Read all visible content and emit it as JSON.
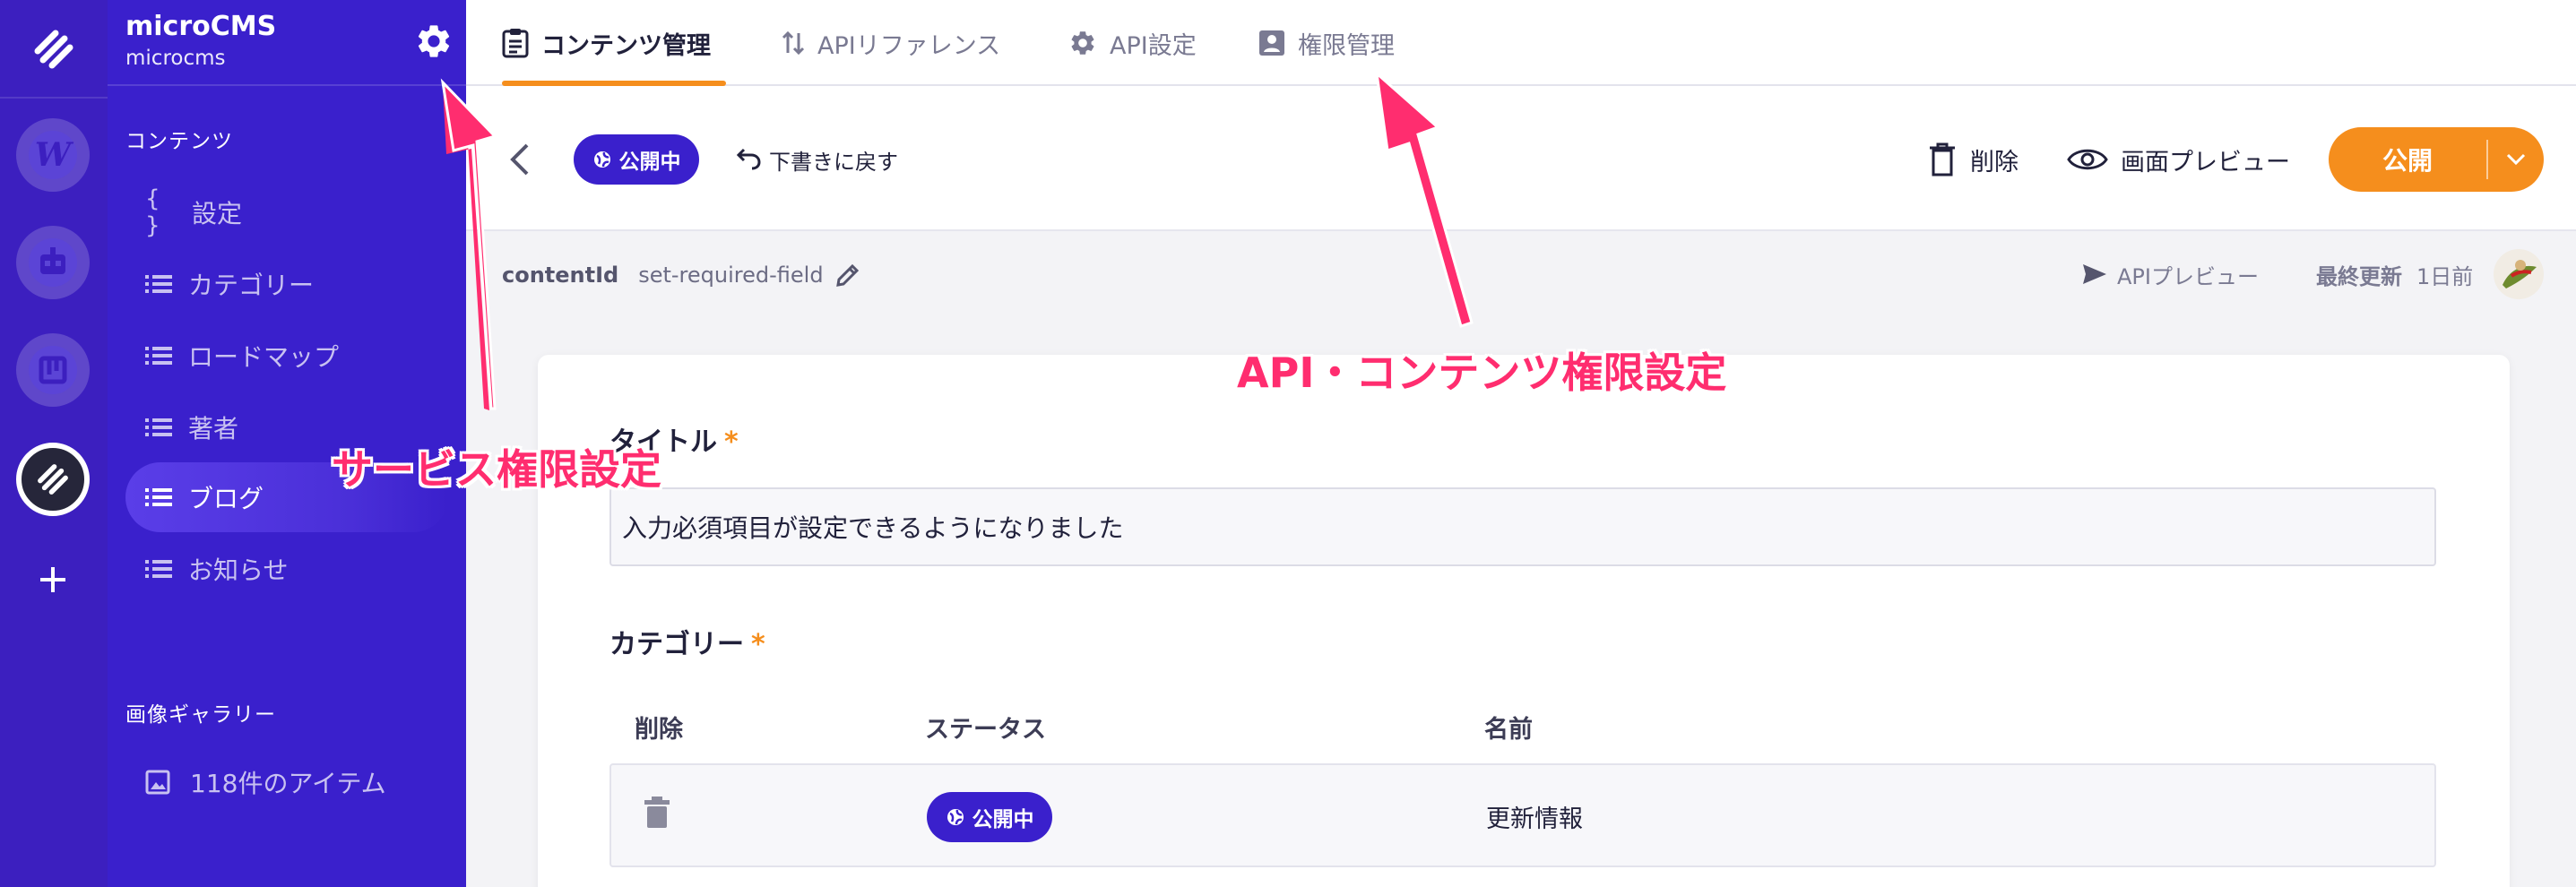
{
  "colors": {
    "brand_purple": "#3a20cc",
    "rail_purple": "#3c1fbf",
    "accent_orange": "#f58e1d",
    "annotation_pink": "#ff2d6f"
  },
  "workspace": {
    "title": "microCMS",
    "subtitle": "microcms"
  },
  "rail": {
    "services": [
      {
        "icon": "wordpress-icon"
      },
      {
        "icon": "robot-icon"
      },
      {
        "icon": "board-icon"
      },
      {
        "icon": "microcms-logo-icon",
        "active": true
      }
    ],
    "add_icon": "plus-icon"
  },
  "sidebar": {
    "contents_heading": "コンテンツ",
    "items": [
      {
        "label": "設定",
        "icon": "braces-icon"
      },
      {
        "label": "カテゴリー",
        "icon": "list-icon"
      },
      {
        "label": "ロードマップ",
        "icon": "list-icon"
      },
      {
        "label": "著者",
        "icon": "list-icon"
      },
      {
        "label": "ブログ",
        "icon": "list-icon",
        "active": true
      },
      {
        "label": "お知らせ",
        "icon": "list-icon"
      }
    ],
    "gallery_heading": "画像ギャラリー",
    "gallery_item": "118件のアイテム"
  },
  "tabs": [
    {
      "label": "コンテンツ管理",
      "icon": "clipboard-icon",
      "active": true
    },
    {
      "label": "APIリファレンス",
      "icon": "sort-arrows-icon"
    },
    {
      "label": "API設定",
      "icon": "gear-icon"
    },
    {
      "label": "権限管理",
      "icon": "account-box-icon"
    }
  ],
  "actions": {
    "status_badge": "公開中",
    "revert": "下書きに戻す",
    "delete": "削除",
    "preview": "画面プレビュー",
    "publish": "公開"
  },
  "meta": {
    "content_id_label": "contentId",
    "content_id_value": "set-required-field",
    "api_preview": "APIプレビュー",
    "last_updated_label": "最終更新",
    "last_updated_value": "1日前"
  },
  "form": {
    "title_label": "タイトル",
    "title_required": "*",
    "title_value": "入力必須項目が設定できるようになりました",
    "category_label": "カテゴリー",
    "category_required": "*",
    "table_headers": {
      "delete": "削除",
      "status": "ステータス",
      "name": "名前"
    },
    "rows": [
      {
        "status": "公開中",
        "name": "更新情報"
      }
    ]
  },
  "annotations": {
    "service_permission": "サービス権限設定",
    "api_content_permission": "API・コンテンツ権限設定"
  }
}
